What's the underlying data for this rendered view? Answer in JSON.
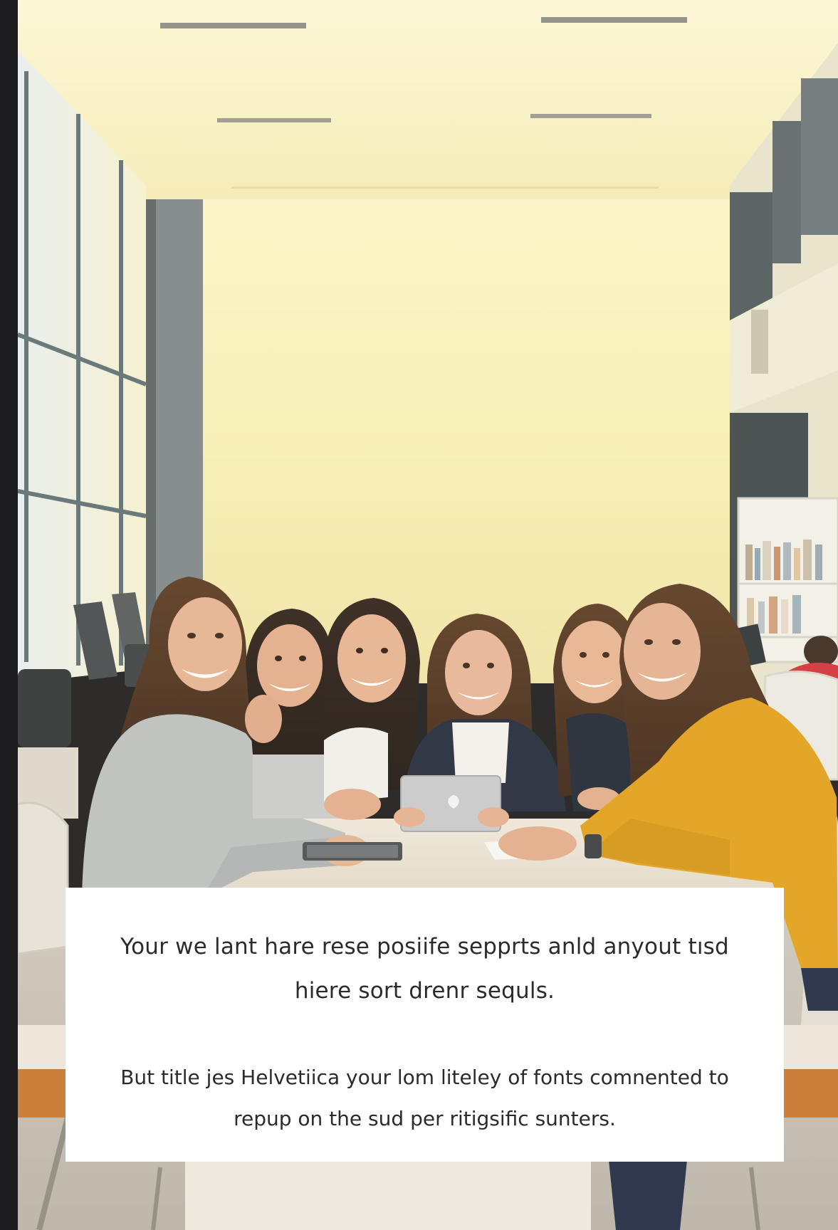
{
  "caption": {
    "paragraph_1": "Your we lant hare rese posiife sepprts anld anyout tısd hiere sort drenr sequls.",
    "paragraph_2": "But title jes Helvetiica your lom liteley of fonts comnented to repup on the sud per ritigsific sunters."
  },
  "photo": {
    "subject": "group-of-students-at-library-table",
    "colors": {
      "wall": "#f7f0b8",
      "ceiling": "#fbf3c4",
      "sweater_yellow": "#e4a51c",
      "laptop": "#c9c9cc"
    }
  },
  "icons": {
    "laptop_logo": "apple-logo-icon"
  }
}
